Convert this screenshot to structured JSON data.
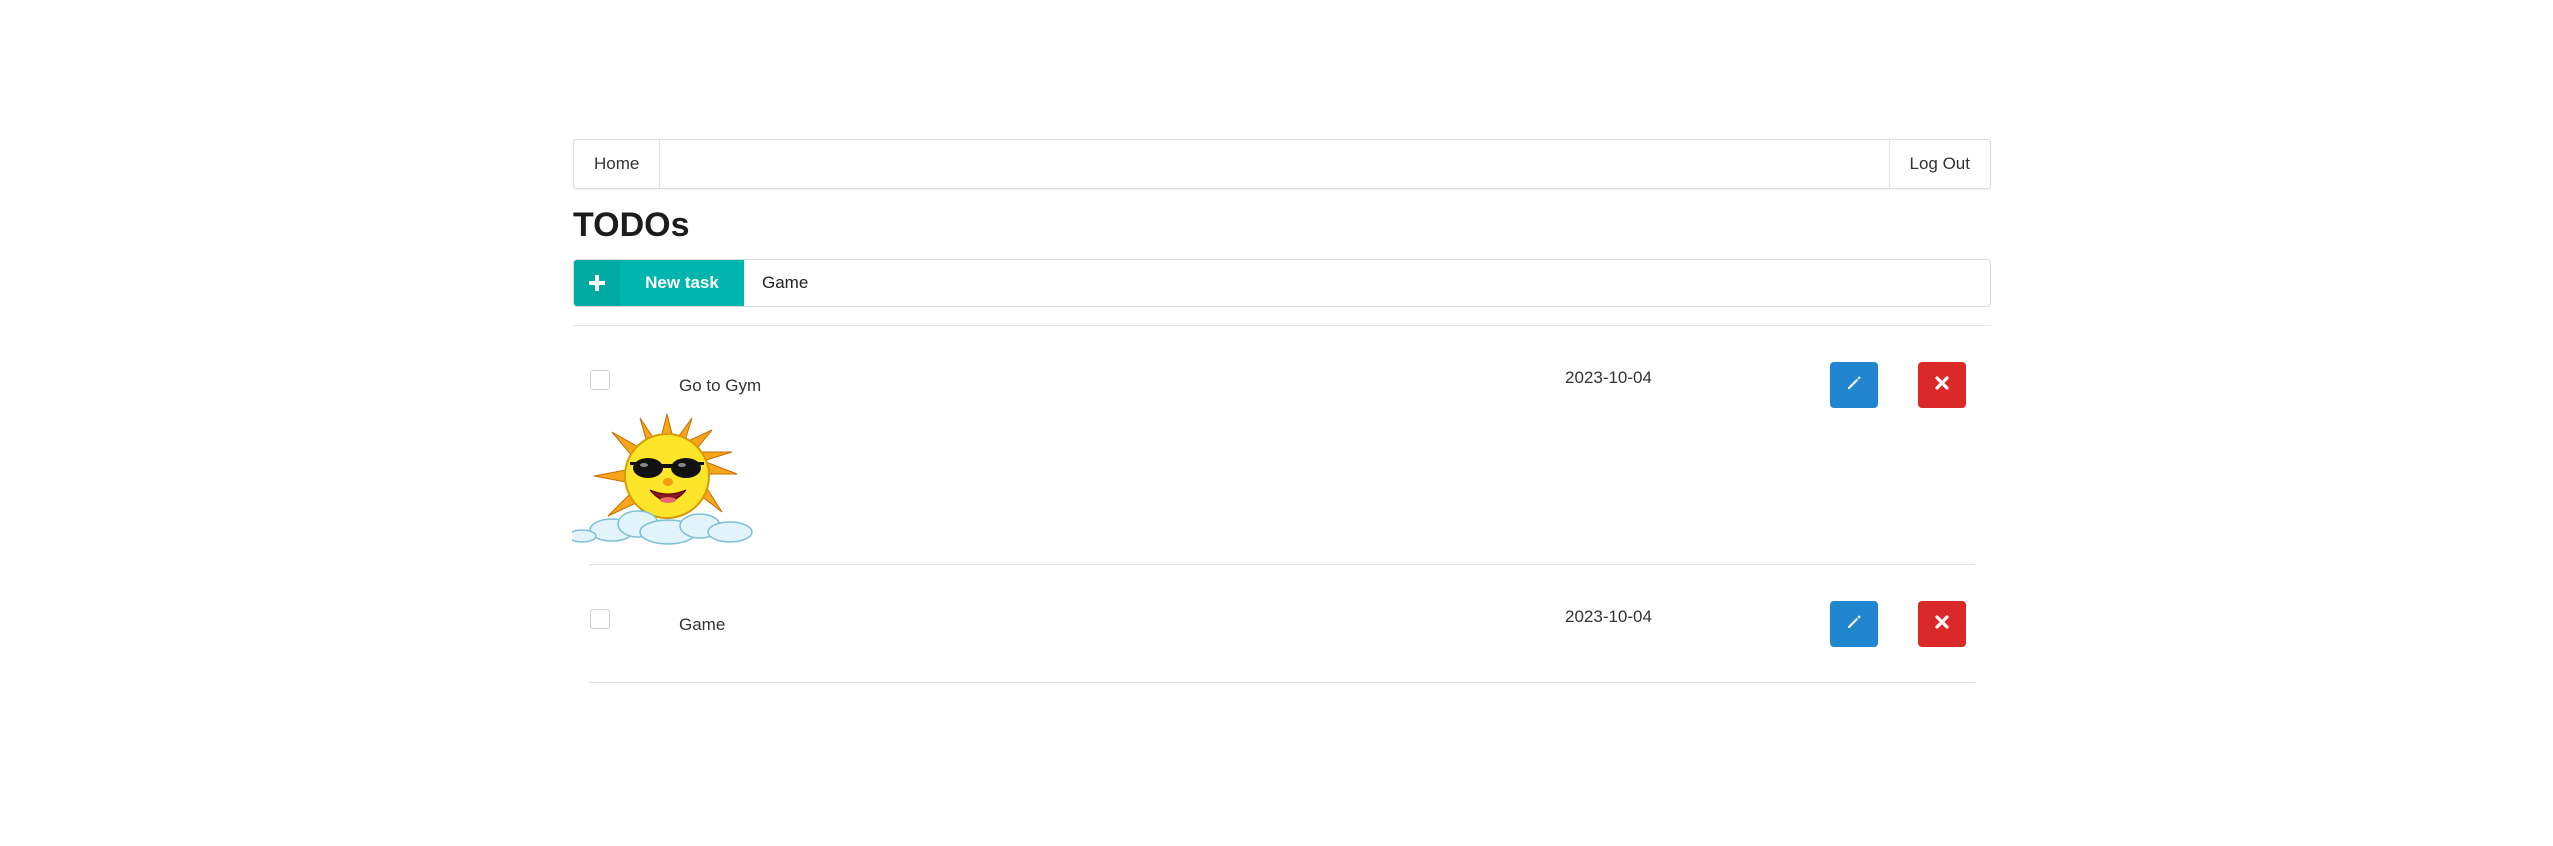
{
  "nav": {
    "home": "Home",
    "logout": "Log Out"
  },
  "page": {
    "title": "TODOs"
  },
  "new_task": {
    "button_label": "New task",
    "input_value": "Game",
    "button_color": "#00b5ad"
  },
  "tasks": [
    {
      "title": "Go to Gym",
      "date": "2023-10-04",
      "completed": false,
      "has_image": true,
      "image_icon": "sun-with-sunglasses"
    },
    {
      "title": "Game",
      "date": "2023-10-04",
      "completed": false,
      "has_image": false
    }
  ],
  "actions": {
    "edit_icon": "pencil-icon",
    "delete_icon": "close-icon",
    "edit_color": "#2185d0",
    "delete_color": "#db2828"
  }
}
